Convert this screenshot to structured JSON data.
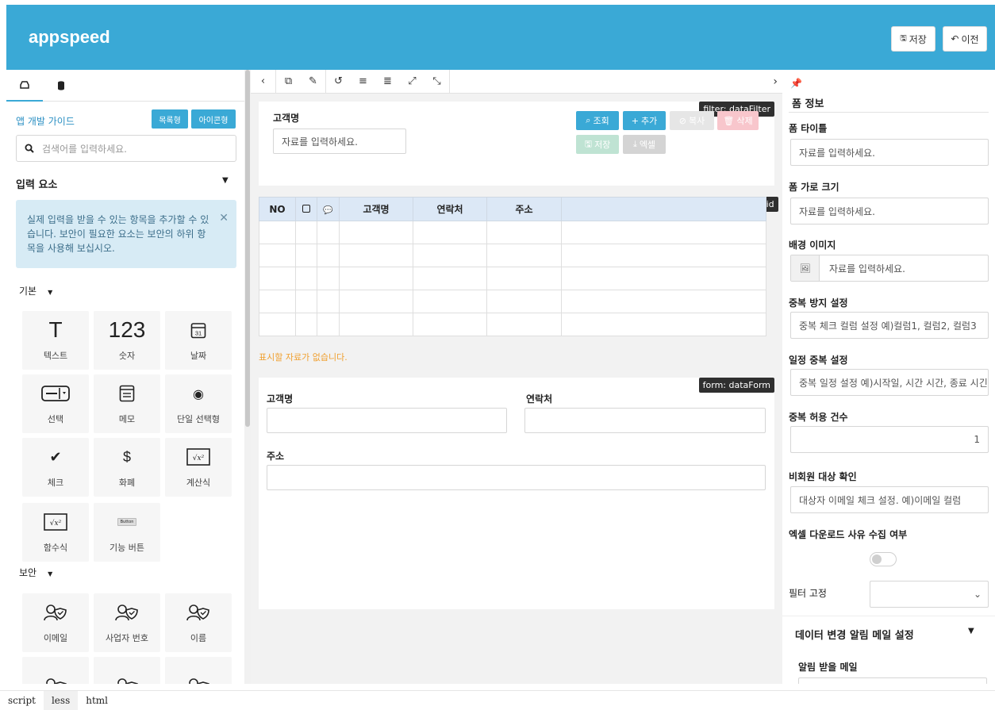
{
  "header": {
    "logo": "appspeed",
    "save_label": "저장",
    "prev_label": "이전"
  },
  "left": {
    "guide_title": "앱 개발 가이드",
    "btn_list": "목록형",
    "btn_icon": "아이콘형",
    "search_placeholder": "검색어를 입력하세요.",
    "section_input": "입력 요소",
    "alert_text": "실제 입력을 받을 수 있는 항목을 추가할 수 있습니다. 보안이 필요한 요소는 보안의 하위 항목을 사용해 보십시오.",
    "group_basic": "기본",
    "group_security": "보안",
    "tiles": [
      {
        "label": "텍스트",
        "icon": "text-icon",
        "glyph": "T"
      },
      {
        "label": "숫자",
        "icon": "number-icon",
        "glyph": "123"
      },
      {
        "label": "날짜",
        "icon": "calendar-icon",
        "glyph": "31"
      },
      {
        "label": "선택",
        "icon": "select-icon",
        "glyph": ""
      },
      {
        "label": "메모",
        "icon": "memo-icon",
        "glyph": ""
      },
      {
        "label": "단일 선택형",
        "icon": "radio-icon",
        "glyph": "◉"
      },
      {
        "label": "체크",
        "icon": "check-icon",
        "glyph": "✔"
      },
      {
        "label": "화폐",
        "icon": "currency-icon",
        "glyph": "$"
      },
      {
        "label": "계산식",
        "icon": "formula-icon",
        "glyph": "√x²"
      },
      {
        "label": "함수식",
        "icon": "function-icon",
        "glyph": "√x²"
      },
      {
        "label": "기능 버튼",
        "icon": "button-icon",
        "glyph": "Button"
      }
    ],
    "security_tiles": [
      {
        "label": "이메일",
        "icon": "user-shield-icon"
      },
      {
        "label": "사업자 번호",
        "icon": "user-shield-icon"
      },
      {
        "label": "이름",
        "icon": "user-shield-icon"
      },
      {
        "label": "",
        "icon": "user-shield-icon"
      },
      {
        "label": "",
        "icon": "user-shield-icon"
      },
      {
        "label": "",
        "icon": "user-shield-icon"
      }
    ]
  },
  "center": {
    "filter_tag": "filter: dataFilter",
    "filter_label": "고객명",
    "filter_placeholder": "자료를 입력하세요.",
    "btn_search": "조회",
    "btn_add": "추가",
    "btn_copy": "복사",
    "btn_delete": "삭제",
    "btn_save": "저장",
    "btn_excel": "엑셀",
    "grid_tag": "grid: dataGrid",
    "grid_columns": [
      "NO",
      "",
      "",
      "고객명",
      "연락처",
      "주소",
      ""
    ],
    "empty_message": "표시할 자료가 없습니다.",
    "form_tag": "form: dataForm",
    "form_name": "고객명",
    "form_contact": "연락처",
    "form_address": "주소"
  },
  "right": {
    "section_title": "폼 정보",
    "form_title_label": "폼 타이틀",
    "form_title_placeholder": "자료를 입력하세요.",
    "form_width_label": "폼 가로 크기",
    "form_width_placeholder": "자료를 입력하세요.",
    "bg_image_label": "배경 이미지",
    "bg_image_placeholder": "자료를 입력하세요.",
    "dup_label": "중복 방지 설정",
    "dup_placeholder": "중복 체크 컬럼 설정 예)컬럼1, 컬럼2, 컬럼3",
    "sched_label": "일정 중복 설정",
    "sched_placeholder": "중복 일정 설정 예)시작일, 시간 시간, 종료 시긴",
    "allow_label": "중복 허용 건수",
    "allow_value": "1",
    "nonmember_label": "비회원 대상 확인",
    "nonmember_placeholder": "대상자 이메일 체크 설정. 예)이메일 컬럼",
    "excel_reason_label": "엑셀 다운로드 사유 수집 여부",
    "filter_fix_label": "필터 고정",
    "notify_section": "데이터 변경 알림 메일 설정",
    "notify_mail_label": "알림 받을 메일"
  },
  "bottom_tabs": [
    "script",
    "less",
    "html"
  ]
}
